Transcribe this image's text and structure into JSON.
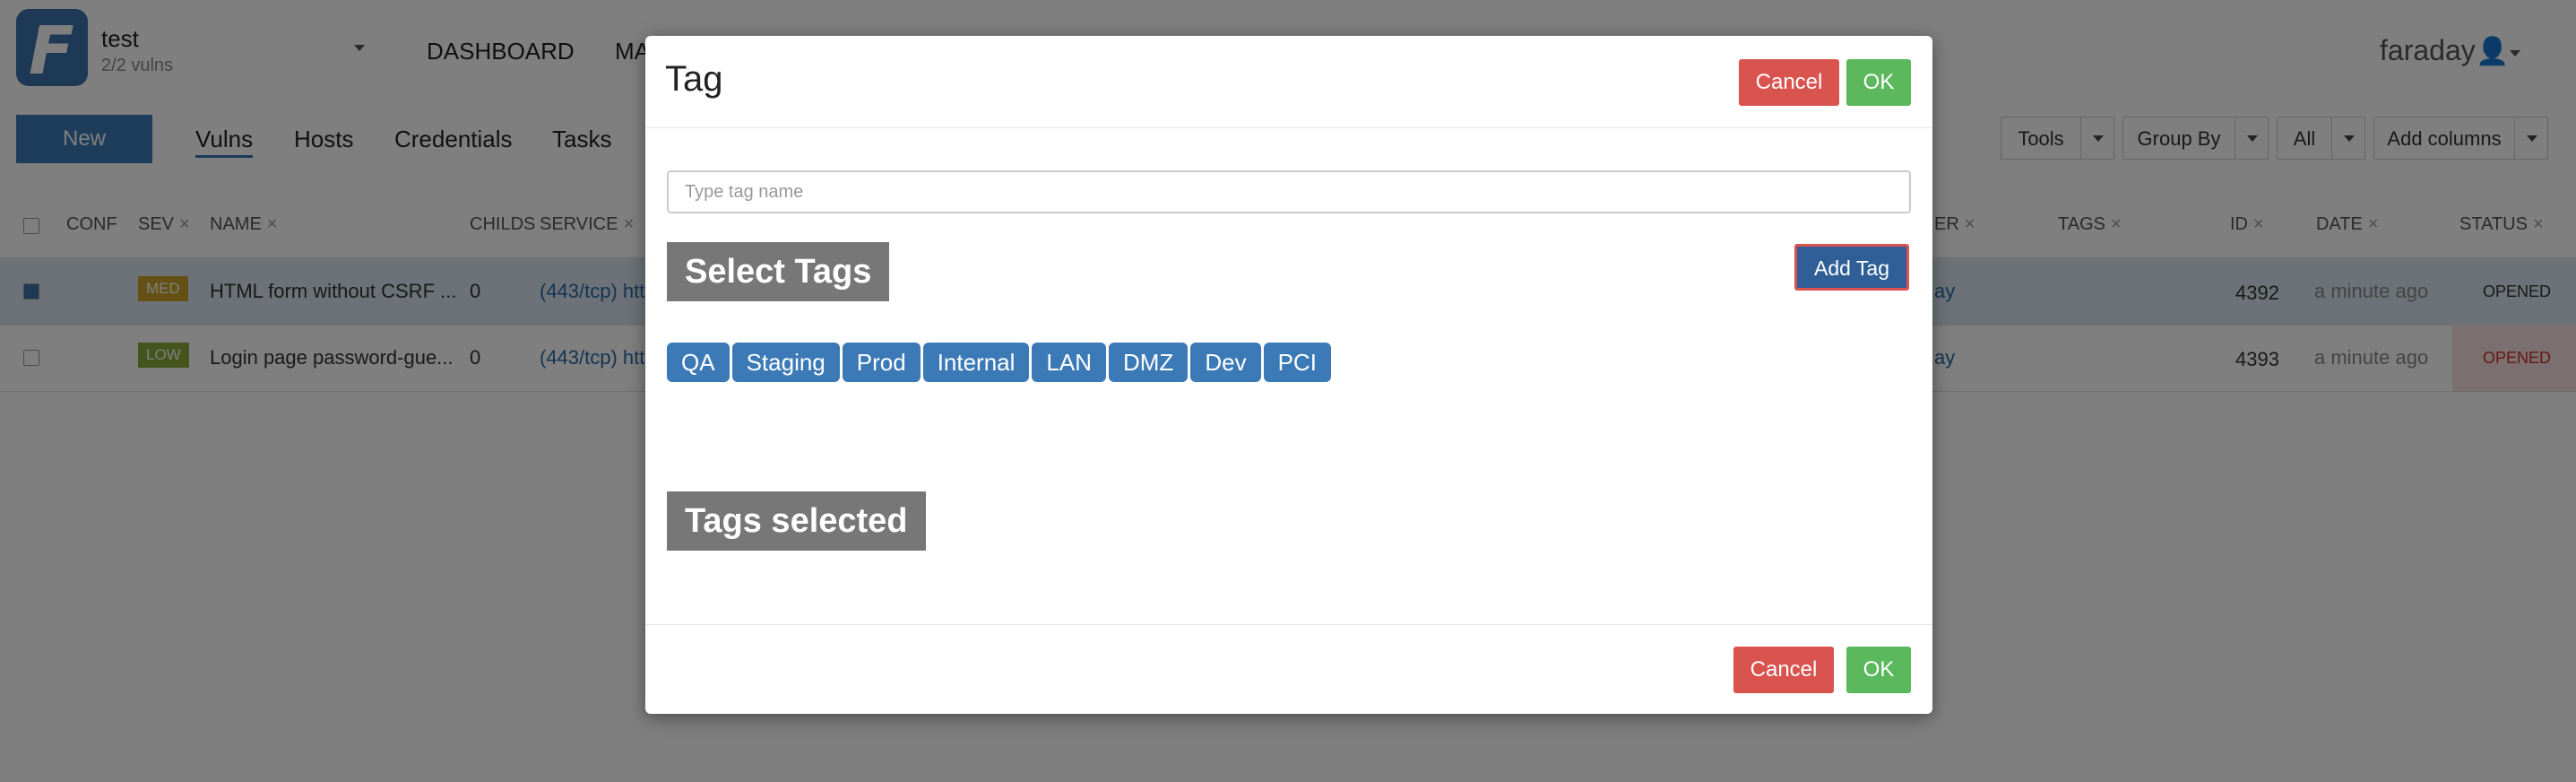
{
  "app": {
    "workspace": "test",
    "vulns_count": "2/2 vulns",
    "nav": [
      "DASHBOARD",
      "MA"
    ],
    "user": "faraday"
  },
  "toolbar": {
    "new_label": "New",
    "tabs": [
      "Vulns",
      "Hosts",
      "Credentials",
      "Tasks"
    ],
    "tools": "Tools",
    "group_by": "Group By",
    "all": "All",
    "add_columns": "Add columns"
  },
  "table": {
    "headers": {
      "conf": "CONF",
      "sev": "SEV",
      "name": "NAME",
      "childs": "CHILDS",
      "service": "SERVICE",
      "er": "ER",
      "tags": "TAGS",
      "id": "ID",
      "date": "DATE",
      "status": "STATUS"
    },
    "remove_mark": "×",
    "rows": [
      {
        "sev": "MED",
        "name": "HTML form without CSRF ...",
        "childs": "0",
        "service": "(443/tcp) htt",
        "creator": "ay",
        "id": "4392",
        "date": "a minute ago",
        "status": "OPENED"
      },
      {
        "sev": "LOW",
        "name": "Login page password-gue...",
        "childs": "0",
        "service": "(443/tcp) htt",
        "creator": "ay",
        "id": "4393",
        "date": "a minute ago",
        "status": "OPENED"
      }
    ]
  },
  "modal": {
    "title": "Tag",
    "cancel_label": "Cancel",
    "ok_label": "OK",
    "input_placeholder": "Type tag name",
    "select_tags_label": "Select Tags",
    "add_tag_label": "Add Tag",
    "tags": [
      "QA",
      "Staging",
      "Prod",
      "Internal",
      "LAN",
      "DMZ",
      "Dev",
      "PCI"
    ],
    "tags_selected_label": "Tags selected"
  },
  "colors": {
    "primary": "#3b7ab7",
    "danger": "#d9534f",
    "success": "#5cb85c",
    "label_gray": "#777777",
    "med": "#c9a227",
    "low": "#8aab3a"
  }
}
